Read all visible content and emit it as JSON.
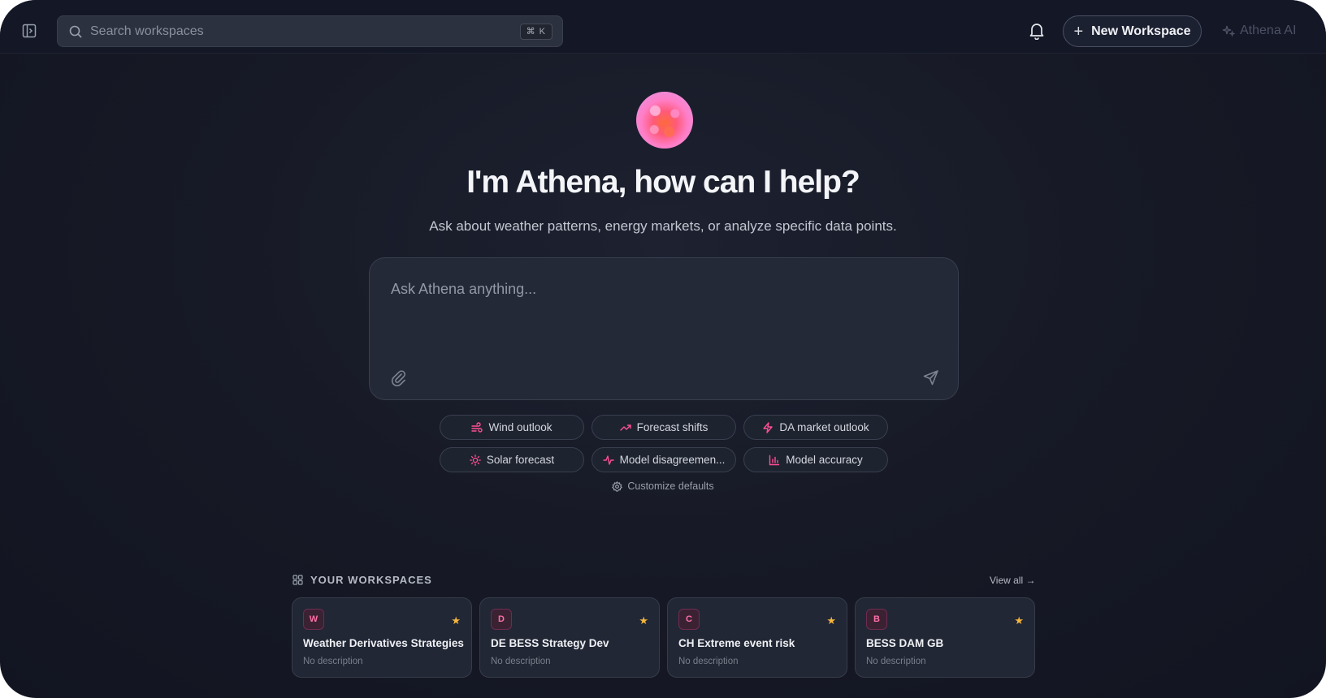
{
  "topbar": {
    "search_placeholder": "Search workspaces",
    "search_shortcut": "⌘ K",
    "new_workspace_label": "New Workspace",
    "athena_ai_label": "Athena AI"
  },
  "hero": {
    "title": "I'm Athena, how can I help?",
    "subtitle": "Ask about weather patterns, energy markets, or analyze specific data points."
  },
  "prompt": {
    "placeholder": "Ask Athena anything..."
  },
  "suggestions": [
    {
      "label": "Wind outlook",
      "icon": "wind-icon"
    },
    {
      "label": "Forecast shifts",
      "icon": "trending-up-icon"
    },
    {
      "label": "DA market outlook",
      "icon": "lightning-icon"
    },
    {
      "label": "Solar forecast",
      "icon": "sun-icon"
    },
    {
      "label": "Model disagreemen...",
      "icon": "activity-icon"
    },
    {
      "label": "Model accuracy",
      "icon": "bar-chart-icon"
    }
  ],
  "customize_label": "Customize defaults",
  "workspaces": {
    "heading": "YOUR WORKSPACES",
    "view_all": "View all →",
    "items": [
      {
        "initial": "W",
        "name": "Weather Derivatives Strategies",
        "description": "No description",
        "starred": true
      },
      {
        "initial": "D",
        "name": "DE BESS Strategy Dev",
        "description": "No description",
        "starred": true
      },
      {
        "initial": "C",
        "name": "CH Extreme event risk",
        "description": "No description",
        "starred": true
      },
      {
        "initial": "B",
        "name": "BESS DAM GB",
        "description": "No description",
        "starred": true
      }
    ]
  },
  "colors": {
    "background": "#171a26",
    "accent_pink": "#ff4f93",
    "star": "#f5b63c"
  }
}
